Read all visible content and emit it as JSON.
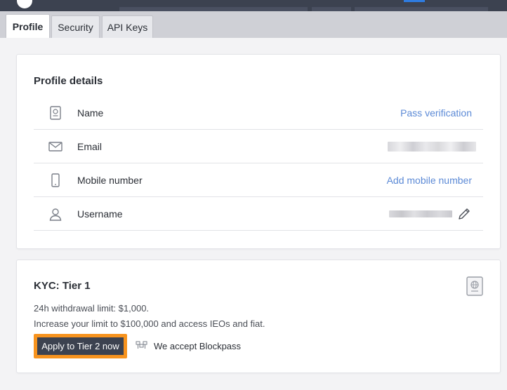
{
  "tabs": [
    {
      "label": "Profile",
      "active": true
    },
    {
      "label": "Security",
      "active": false
    },
    {
      "label": "API Keys",
      "active": false
    }
  ],
  "profile": {
    "title": "Profile details",
    "rows": [
      {
        "icon": "id-card-icon",
        "label": "Name",
        "action": "Pass verification"
      },
      {
        "icon": "envelope-icon",
        "label": "Email",
        "value": ""
      },
      {
        "icon": "mobile-phone-icon",
        "label": "Mobile number",
        "action": "Add mobile number"
      },
      {
        "icon": "user-icon",
        "label": "Username",
        "value": "",
        "edit_icon": "pencil-icon"
      }
    ]
  },
  "kyc": {
    "title": "KYC: Tier 1",
    "withdrawal_limit": "24h withdrawal limit: $1,000.",
    "increase_text": "Increase your limit to $100,000 and access IEOs and fiat.",
    "apply_button": "Apply to Tier 2 now",
    "blockpass_text": "We accept Blockpass",
    "badge_icon": "passport-icon"
  },
  "colors": {
    "link": "#5c8ad6",
    "button_bg": "#3c4250",
    "button_outline": "#f7931e",
    "topbar": "#3c4250"
  }
}
